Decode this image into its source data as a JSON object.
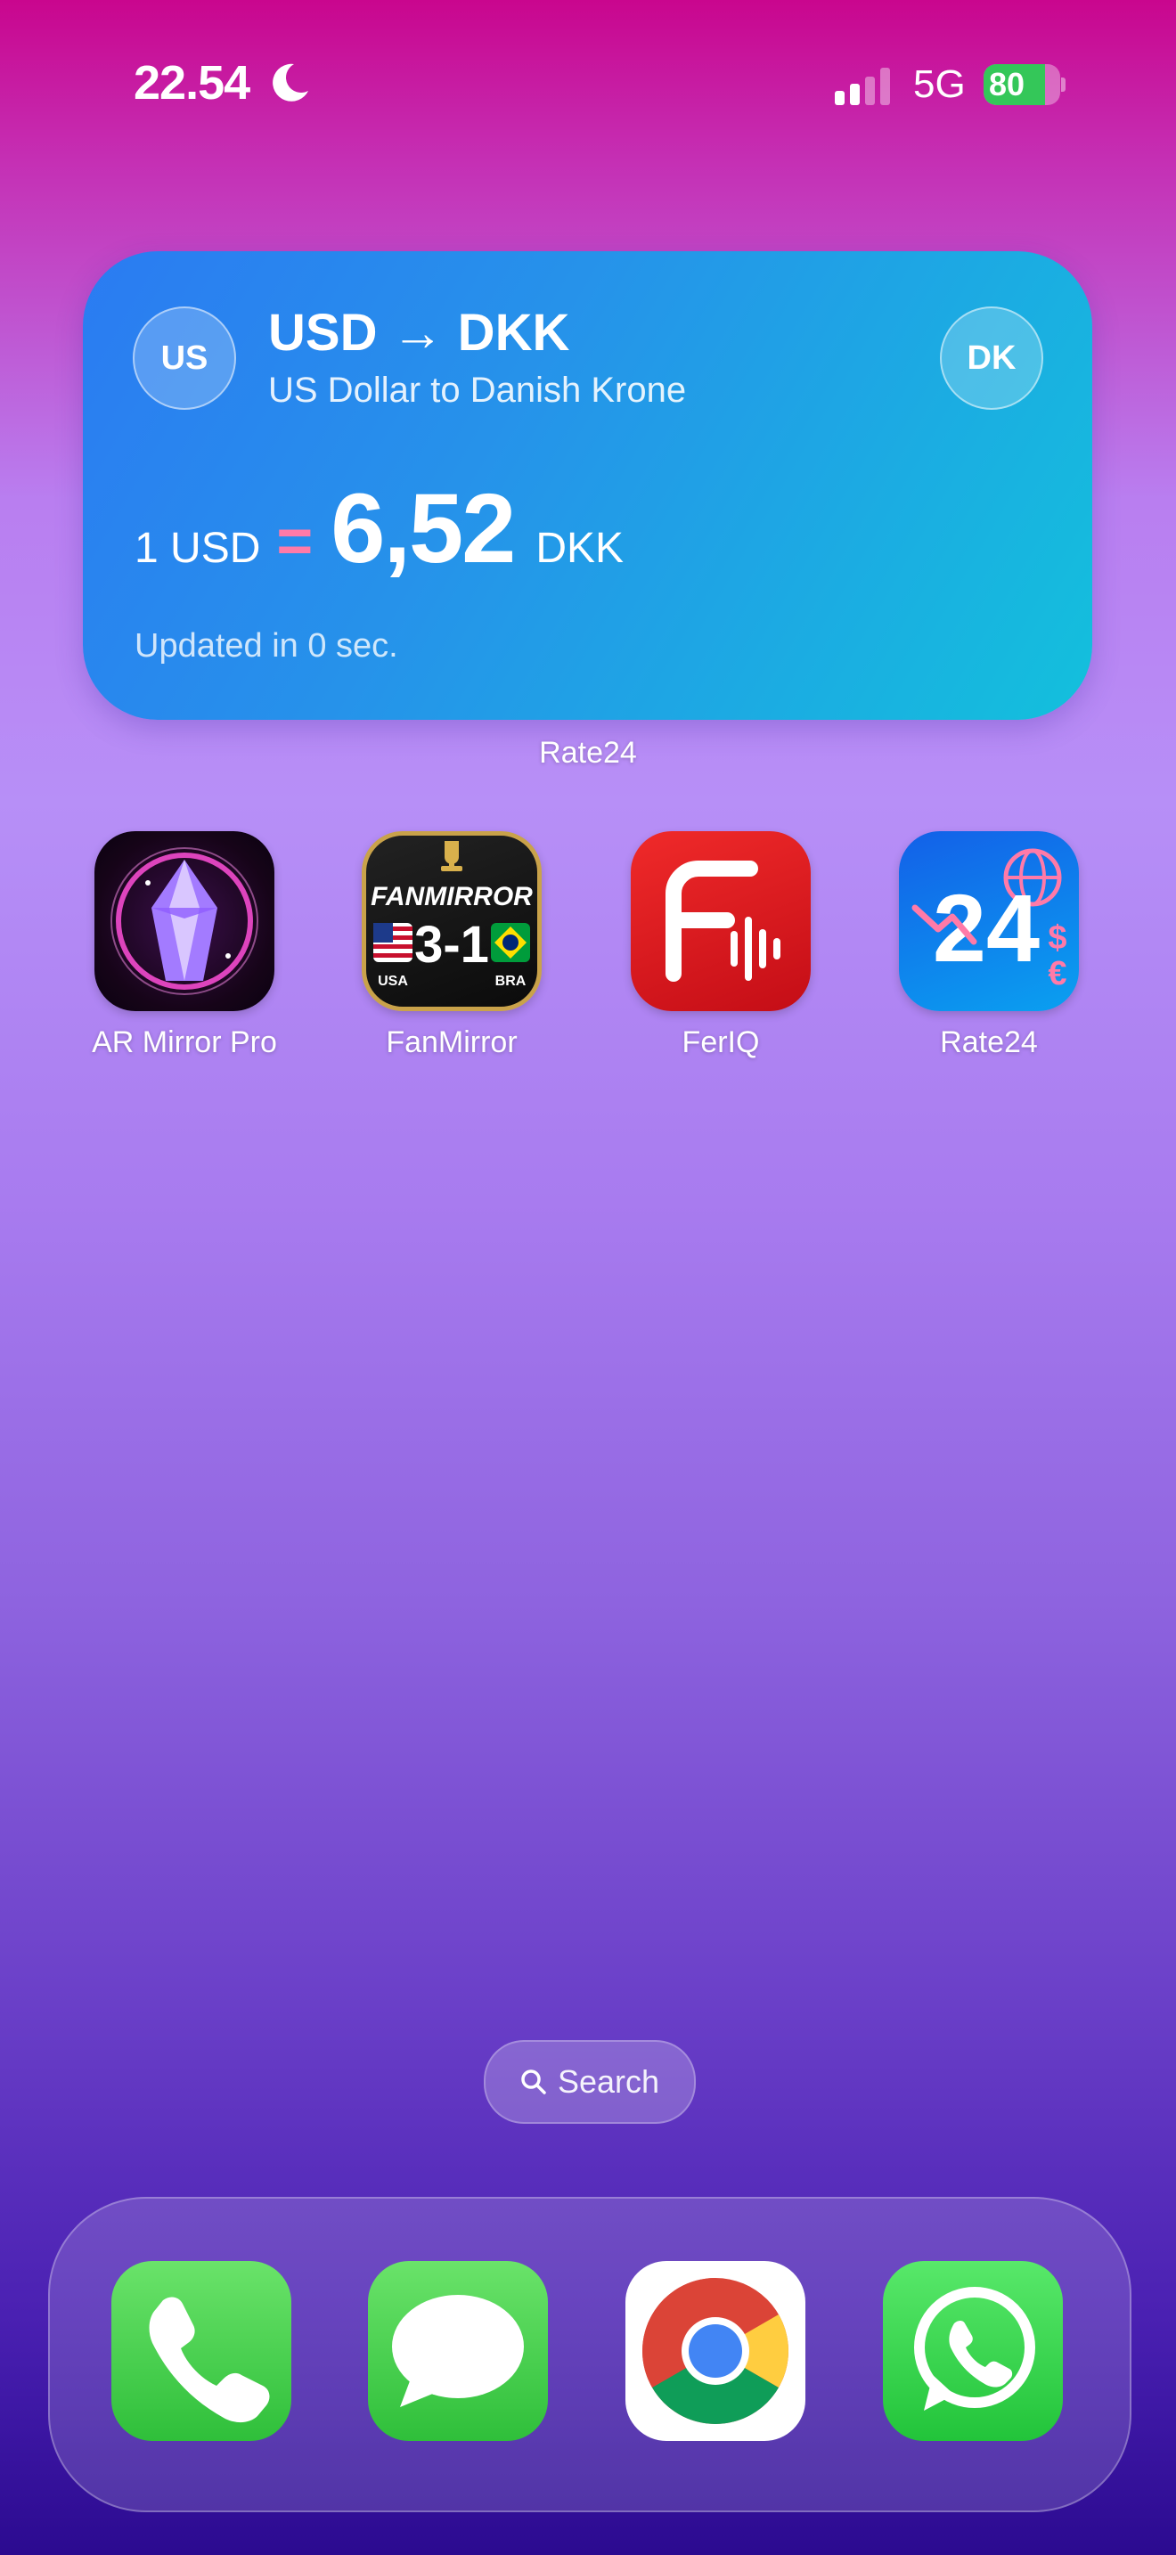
{
  "status_bar": {
    "time": "22.54",
    "focus_icon": "moon-icon",
    "network": "5G",
    "battery": "80",
    "battery_level": 0.8
  },
  "widget": {
    "title": "USD → DKK",
    "subtitle": "US Dollar to Danish Krone",
    "from_code": "US",
    "to_code": "DK",
    "amount_label": "1 USD",
    "equals": "=",
    "value": "6,52",
    "unit": "DKK",
    "updated": "Updated in 0 sec.",
    "app_label": "Rate24",
    "colors": {
      "start": "#2b7bf2",
      "end": "#13c0dc",
      "equals": "#ff7aa8"
    }
  },
  "apps": [
    {
      "label": "AR Mirror Pro",
      "icon": "crystal-icon"
    },
    {
      "label": "FanMirror",
      "icon": "fanmirror-icon",
      "brand": "FANMIRROR",
      "score": "3-1",
      "team_left": "USA",
      "team_right": "BRA"
    },
    {
      "label": "FerIQ",
      "icon": "feriq-icon"
    },
    {
      "label": "Rate24",
      "icon": "rate24-icon",
      "badge": "24"
    }
  ],
  "search": {
    "label": "Search"
  },
  "dock": [
    {
      "name": "phone",
      "icon": "phone-icon"
    },
    {
      "name": "messages",
      "icon": "messages-icon"
    },
    {
      "name": "chrome",
      "icon": "chrome-icon"
    },
    {
      "name": "whatsapp",
      "icon": "whatsapp-icon"
    }
  ]
}
